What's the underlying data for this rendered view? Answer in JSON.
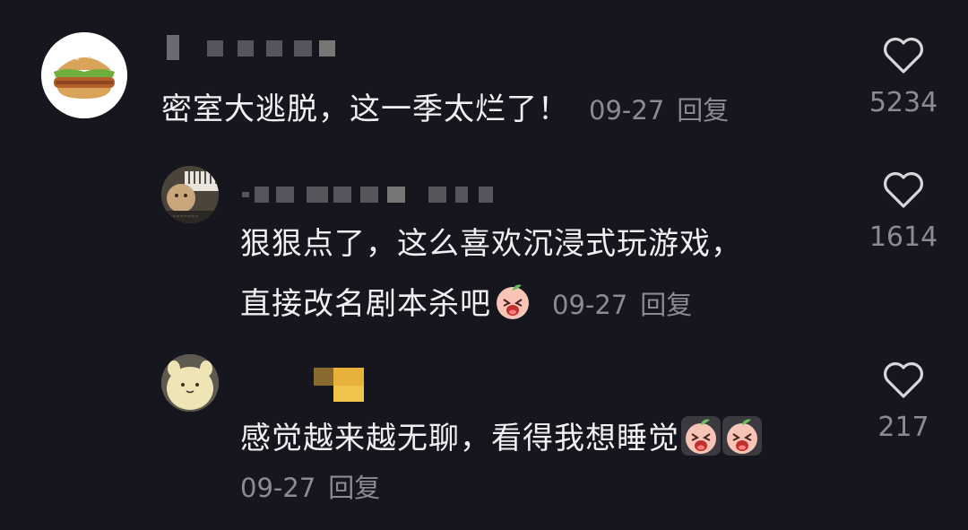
{
  "comments": [
    {
      "text": "密室大逃脱，这一季太烂了！",
      "date": "09-27",
      "reply_label": "回复",
      "likes": "5234",
      "avatar_icon": "burger-icon"
    },
    {
      "text_line1": "狠狠点了，这么喜欢沉浸式玩游戏，",
      "text_line2": "直接改名剧本杀吧",
      "date": "09-27",
      "reply_label": "回复",
      "likes": "1614",
      "avatar_icon": "piano-photo-icon",
      "emoji_count": 1
    },
    {
      "text": "感觉越来越无聊，看得我想睡觉",
      "date": "09-27",
      "reply_label": "回复",
      "likes": "217",
      "avatar_icon": "plush-toy-icon",
      "emoji_count": 2
    }
  ],
  "colors": {
    "background": "#16161e",
    "text": "#f0f0f2",
    "secondary": "#8b8b92"
  },
  "icons": {
    "like": "heart-outline-icon",
    "emoji": "crying-peach-emoji-icon"
  }
}
